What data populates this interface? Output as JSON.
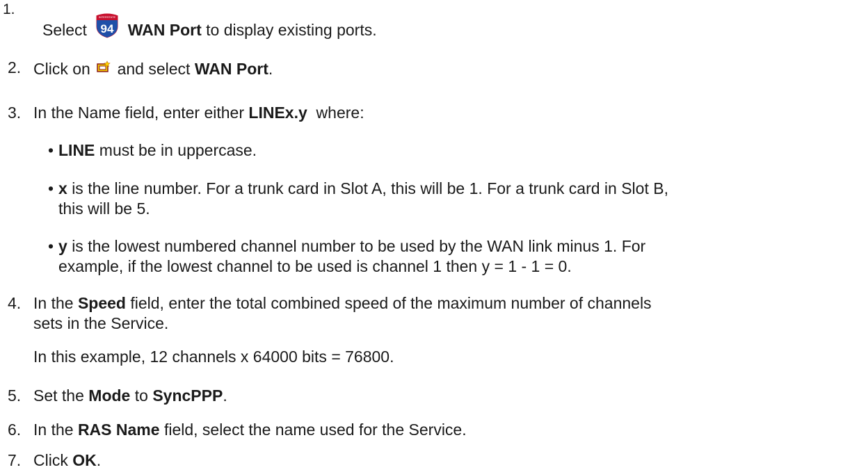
{
  "steps": [
    {
      "num": "1.",
      "pre": "Select",
      "bold1": "WAN Port",
      "post": "to display existing ports."
    },
    {
      "num": "2.",
      "pre": "Click on",
      "mid": "and select",
      "bold1": "WAN Port",
      "post": "."
    },
    {
      "num": "3.",
      "pre": "In the Name field, enter either",
      "bold1": "LINEx.y",
      "post": "where:"
    },
    {
      "num": "4.",
      "pre": "In the",
      "bold1": "Speed",
      "post": "field, enter the total combined speed of the maximum number of channels",
      "line2": "sets in the Service.",
      "note": "In this example, 12 channels x 64000 bits = 76800."
    },
    {
      "num": "5.",
      "pre": "Set the",
      "bold1": "Mode",
      "mid": "to",
      "bold2": "SyncPPP",
      "post": "."
    },
    {
      "num": "6.",
      "pre": "In the",
      "bold1": "RAS Name",
      "post": "field, select the name used for the Service."
    },
    {
      "num": "7.",
      "pre": "Click",
      "bold1": "OK",
      "post": "."
    }
  ],
  "bullets": [
    {
      "bold": "LINE",
      "text": "must be in uppercase."
    },
    {
      "bold": "x",
      "text": "is the line number. For a trunk card in Slot A, this will be 1. For a trunk card in Slot B,",
      "line2": "this will be 5."
    },
    {
      "bold": "y",
      "text": "is the lowest numbered channel number to be used by the WAN link minus 1. For",
      "line2": "example, if the lowest channel to be used is channel 1 then y = 1 - 1 = 0."
    }
  ],
  "icons": {
    "step1": "interstate-94-shield-icon",
    "step2": "new-item-icon",
    "shield_number": "94",
    "shield_top": "INTERSTATE"
  }
}
